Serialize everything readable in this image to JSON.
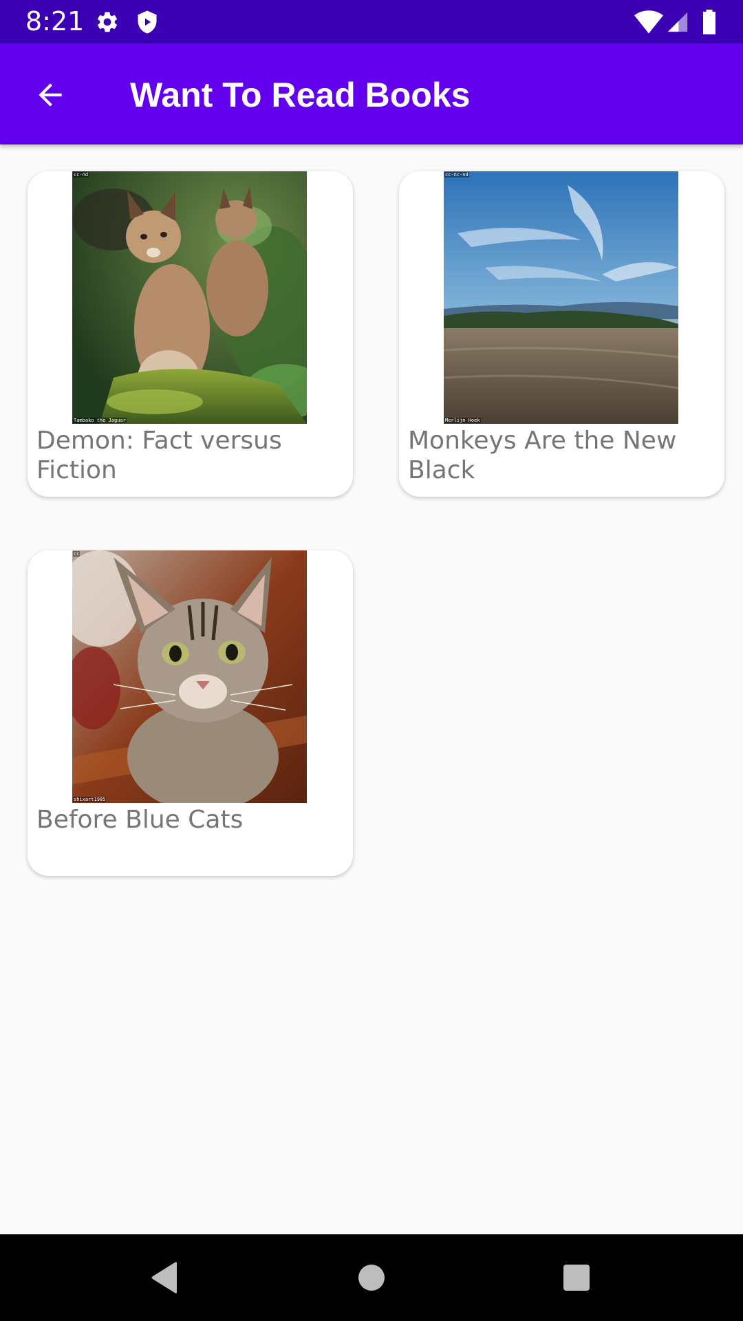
{
  "status_bar": {
    "time": "8:21",
    "icons": [
      "gear-icon",
      "shield-icon",
      "wifi-icon",
      "signal-icon",
      "battery-icon"
    ]
  },
  "app_bar": {
    "title": "Want To Read Books",
    "back_icon": "arrow-left-icon"
  },
  "books": [
    {
      "title": "Demon: Fact versus Fiction",
      "cover": "lynx-photo",
      "caption_top": "cc-nd",
      "caption_bottom": "Tambako the Jaguar"
    },
    {
      "title": "Monkeys Are the New Black",
      "cover": "sky-field-photo",
      "caption_top": "cc-nc-nd",
      "caption_bottom": "Merlijn Hoek"
    },
    {
      "title": "Before Blue Cats",
      "cover": "tabby-cat-photo",
      "caption_top": "cc",
      "caption_bottom": "shixart1985"
    }
  ],
  "nav_bar": {
    "icons": [
      "back-triangle-icon",
      "home-circle-icon",
      "recents-square-icon"
    ]
  },
  "colors": {
    "status_bar": "#3B00B3",
    "app_bar": "#6200EE",
    "background": "#FAFAFA",
    "title_text": "#757575"
  }
}
